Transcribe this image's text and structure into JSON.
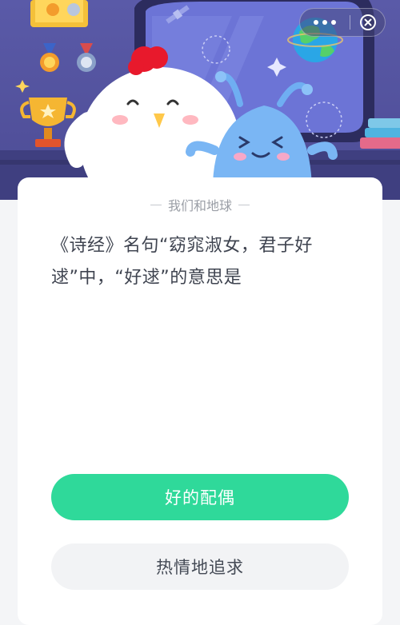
{
  "header": {
    "menu_icon": "more-dots-icon",
    "close_icon": "close-circle-icon",
    "illustration": "chick-and-alien-mascots-in-space-room"
  },
  "card": {
    "section_title": "我们和地球",
    "question": "《诗经》名句“窈窕淑女，君子好逑”中，“好逑”的意思是",
    "options": [
      {
        "label": "好的配偶",
        "state": "highlighted"
      },
      {
        "label": "热情地追求",
        "state": "normal"
      }
    ]
  },
  "colors": {
    "banner": "#5a5aa8",
    "accent_green": "#2fd99a",
    "option_neutral": "#f2f3f5",
    "question_text": "#3f4450"
  }
}
